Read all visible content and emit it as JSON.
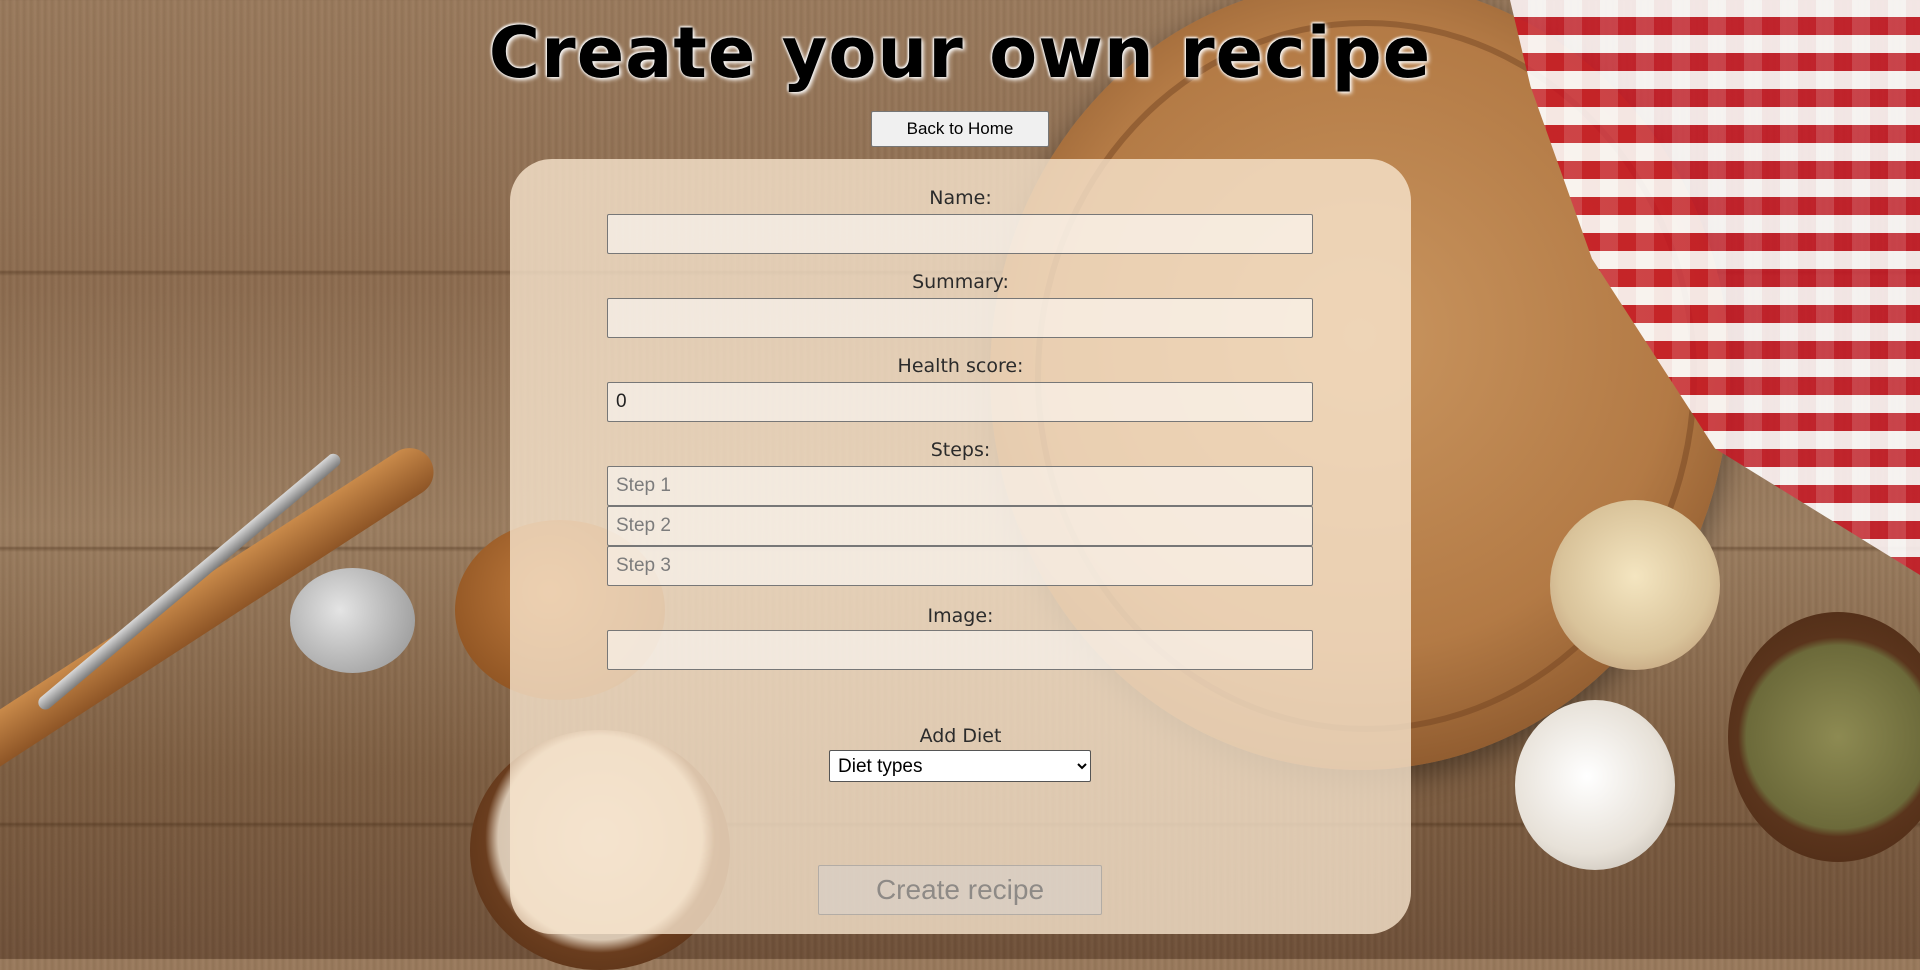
{
  "page": {
    "title": "Create your own recipe",
    "back_button": "Back to Home"
  },
  "form": {
    "name": {
      "label": "Name:",
      "value": ""
    },
    "summary": {
      "label": "Summary:",
      "value": ""
    },
    "health_score": {
      "label": "Health score:",
      "value": "0"
    },
    "steps": {
      "label": "Steps:",
      "placeholders": [
        "Step 1",
        "Step 2",
        "Step 3"
      ]
    },
    "image": {
      "label": "Image:",
      "value": ""
    },
    "diet": {
      "label": "Add Diet",
      "selected": "Diet types"
    },
    "submit_label": "Create recipe"
  },
  "colors": {
    "card_background": "#f7e5cd",
    "title_text": "#000000",
    "button_background": "#f0f0f0"
  }
}
